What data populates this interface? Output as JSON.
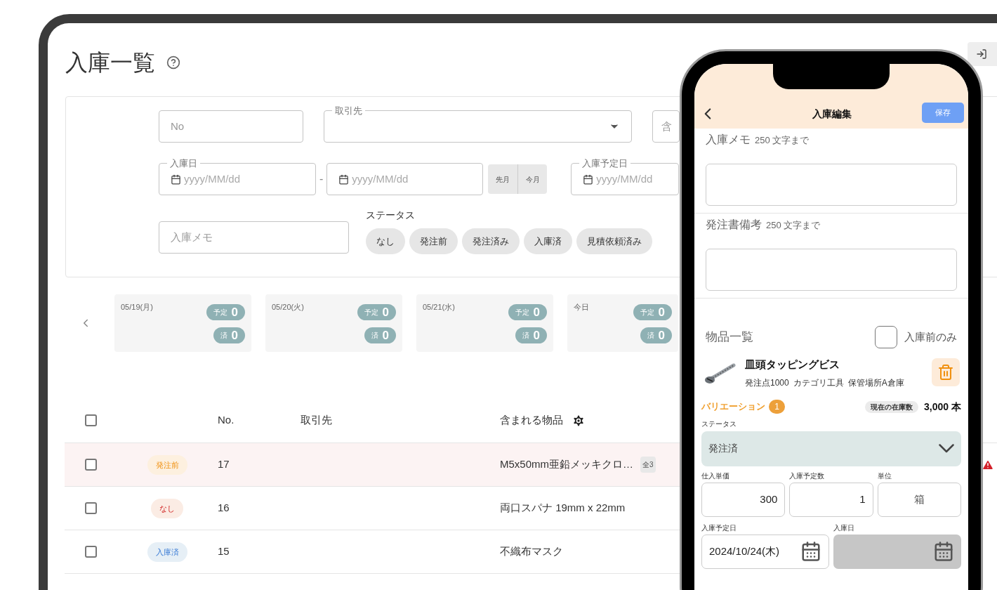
{
  "page": {
    "title": "入庫一覧"
  },
  "filters": {
    "no": {
      "placeholder": "No"
    },
    "supplier": {
      "label": "取引先"
    },
    "items": {
      "placeholder": "含"
    },
    "received_date": {
      "label": "入庫日",
      "from_placeholder": "yyyy/MM/dd",
      "separator": "-",
      "to_placeholder": "yyyy/MM/dd"
    },
    "quick_buttons": [
      "先月",
      "今月"
    ],
    "planned_date": {
      "label": "入庫予定日",
      "from_placeholder": "yyyy/MM/dd"
    },
    "memo": {
      "placeholder": "入庫メモ"
    },
    "status": {
      "label": "ステータス",
      "chips": [
        {
          "label": "なし",
          "selected": false
        },
        {
          "label": "発注前",
          "selected": false
        },
        {
          "label": "発注済み",
          "selected": false
        },
        {
          "label": "入庫済",
          "selected": false
        },
        {
          "label": "見積依頼済み",
          "selected": false
        }
      ]
    }
  },
  "calendar": [
    {
      "date": "05/19(月)",
      "planned_label": "予定",
      "planned": "0",
      "done_label": "済",
      "done": "0"
    },
    {
      "date": "05/20(火)",
      "planned_label": "予定",
      "planned": "0",
      "done_label": "済",
      "done": "0"
    },
    {
      "date": "05/21(水)",
      "planned_label": "予定",
      "planned": "0",
      "done_label": "済",
      "done": "0"
    },
    {
      "date": "今日",
      "planned_label": "予定",
      "planned": "0",
      "done_label": "済",
      "done": "0"
    }
  ],
  "table": {
    "all_checked": false,
    "columns": [
      "No.",
      "取引先",
      "含まれる物品"
    ],
    "rows": [
      {
        "status": "発注前",
        "kind": "before_order",
        "no": "17",
        "items": "M5x50mm亜鉛メッキクロ…",
        "count": "全3",
        "highlighted": true,
        "warning": true,
        "checked": false
      },
      {
        "status": "なし",
        "kind": "none",
        "no": "16",
        "items": "両口スパナ 19mm x 22mm",
        "highlighted": false,
        "warning": false,
        "checked": false
      },
      {
        "status": "入庫済",
        "kind": "received",
        "no": "15",
        "items": "不織布マスク",
        "highlighted": false,
        "warning": false,
        "checked": false
      }
    ]
  },
  "phone": {
    "title": "入庫編集",
    "save": "保存",
    "notes": [
      {
        "label": "入庫メモ",
        "hint": "250 文字まで"
      },
      {
        "label": "発注書備考",
        "hint": "250 文字まで"
      }
    ],
    "items_title": "物品一覧",
    "before_only": {
      "label": "入庫前のみ",
      "checked": false
    },
    "product": {
      "name": "皿頭タッピングビス",
      "meta": [
        "発注点1000",
        "カテゴリ工具",
        "保管場所A倉庫"
      ]
    },
    "variation": {
      "label": "バリエーション",
      "count": "1",
      "stock_label": "現在の在庫数",
      "stock": "3,000 本"
    },
    "status": {
      "label": "ステータス",
      "value": "発注済"
    },
    "fields": [
      {
        "label": "仕入単価",
        "value": "300",
        "kind": "number"
      },
      {
        "label": "入庫予定数",
        "value": "1",
        "kind": "number"
      },
      {
        "label": "単位",
        "value": "箱",
        "kind": "text"
      }
    ],
    "dates": [
      {
        "label": "入庫予定日",
        "value": "2024/10/24(木)",
        "disabled": false
      },
      {
        "label": "入庫日",
        "disabled": true
      }
    ]
  }
}
